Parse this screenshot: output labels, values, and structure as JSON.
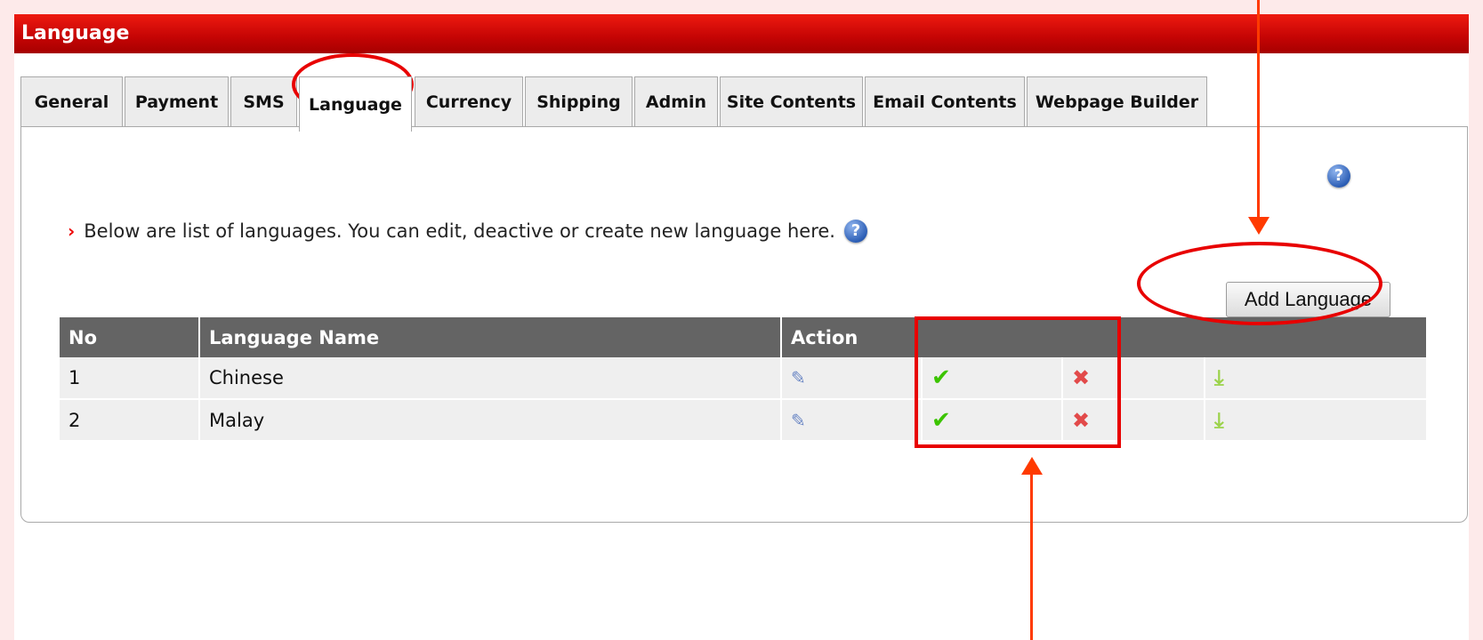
{
  "window": {
    "title": "Language"
  },
  "tabs": [
    {
      "label": "General"
    },
    {
      "label": "Payment"
    },
    {
      "label": "SMS"
    },
    {
      "label": "Language",
      "active": true
    },
    {
      "label": "Currency"
    },
    {
      "label": "Shipping"
    },
    {
      "label": "Admin"
    },
    {
      "label": "Site Contents"
    },
    {
      "label": "Email Contents"
    },
    {
      "label": "Webpage Builder"
    }
  ],
  "content": {
    "intro": "Below are list of languages. You can edit, deactive or create new language here.",
    "help_glyph": "?",
    "add_button": "Add Language"
  },
  "table": {
    "headers": [
      "No",
      "Language Name",
      "Action"
    ],
    "rows": [
      {
        "no": "1",
        "name": "Chinese"
      },
      {
        "no": "2",
        "name": "Malay"
      }
    ]
  },
  "icons": {
    "edit": "✎",
    "activate": "✔",
    "delete": "✖",
    "download": "⤓"
  },
  "colors": {
    "title_bar": "#c40404",
    "annotation": "#e80000",
    "header_row": "#646464"
  }
}
